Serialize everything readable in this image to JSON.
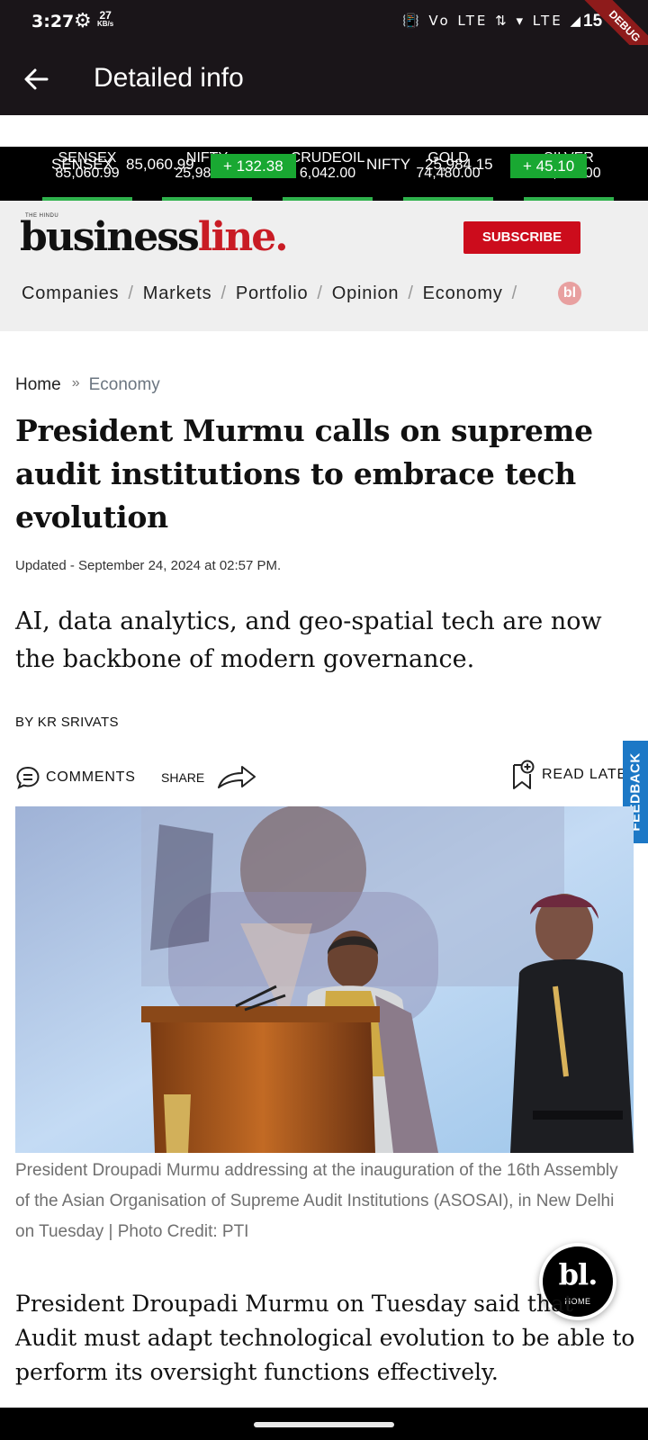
{
  "status_bar": {
    "time": "3:27",
    "data_speed": "27",
    "data_speed_unit": "KB/s",
    "icons": "📳 Vo LTE ⇅ ▾ LTE ◢",
    "battery": "15",
    "debug_label": "DEBUG"
  },
  "app_bar": {
    "title": "Detailed info"
  },
  "ticker": {
    "items": [
      {
        "name": "SENSEX",
        "value": "85,060.99"
      },
      {
        "name": "NIFTY",
        "value": "25,984.15"
      },
      {
        "name": "CRUDEOIL",
        "value": "6,042.00"
      },
      {
        "name": "GOLD",
        "value": "74,480.00"
      },
      {
        "name": "SILVER",
        "value": "89,584.00"
      }
    ],
    "overlay_1_name": "SENSEX",
    "overlay_1_value": "85,060.99",
    "overlay_1_change": "+ 132.38",
    "overlay_2_name": "NIFTY",
    "overlay_2_value": "25,984.15",
    "overlay_2_change": "+ 45.10",
    "bar_color": "#2fb24c",
    "change_color": "#19a832"
  },
  "masthead": {
    "logo_small": "THE HINDU",
    "logo_business": "business",
    "logo_line": "line",
    "logo_dot": ".",
    "subscribe_label": "SUBSCRIBE",
    "nav": [
      "Companies",
      "Markets",
      "Portfolio",
      "Opinion",
      "Economy"
    ],
    "nav_separator": "/",
    "nav_more": "bl",
    "brand_red": "#c91c25"
  },
  "article": {
    "breadcrumb": [
      "Home",
      "Economy"
    ],
    "breadcrumb_separator": "»",
    "headline": "President Murmu calls on supreme audit institutions to embrace tech evolution",
    "updated": "Updated - September 24, 2024 at 02:57 PM.",
    "subheadline": "AI, data analytics, and geo-spatial tech are now the backbone of modern governance.",
    "byline": "BY KR SRIVATS",
    "actions": {
      "comments_label": "COMMENTS",
      "share_label": "SHARE",
      "read_later_label": "READ LATER"
    },
    "caption": "President Droupadi Murmu addressing at the inauguration of the 16th Assembly of the Asian Organisation of Supreme Audit Institutions (ASOSAI), in New Delhi on Tuesday | Photo Credit: PTI",
    "body": "President Droupadi Murmu on Tuesday said that Audit must adapt technological evolution to be able to perform its oversight functions effectively."
  },
  "feedback_label": "FEEDBACK",
  "home_fab": {
    "logo": "bl.",
    "label": "HOME"
  }
}
